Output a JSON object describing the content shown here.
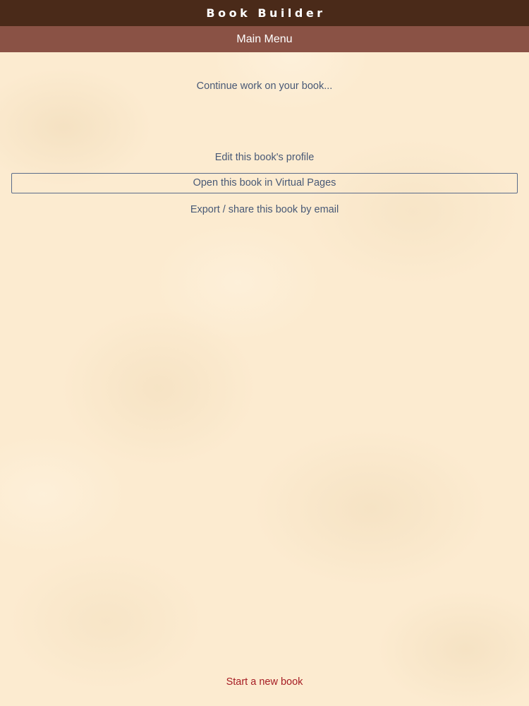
{
  "header": {
    "app_title": "Book Builder",
    "screen_title": "Main Menu"
  },
  "main": {
    "continue_heading": "Continue work on your book...",
    "menu": {
      "edit_profile": "Edit this book's profile",
      "open_virtual_pages": "Open this book in Virtual Pages",
      "export_share": "Export / share this book by email"
    }
  },
  "footer": {
    "start_new": "Start a new book"
  },
  "colors": {
    "title_bar": "#4a2a19",
    "sub_bar": "#8a5245",
    "link_text": "#485976",
    "start_new_text": "#a61d24",
    "background": "#fcebd0"
  }
}
